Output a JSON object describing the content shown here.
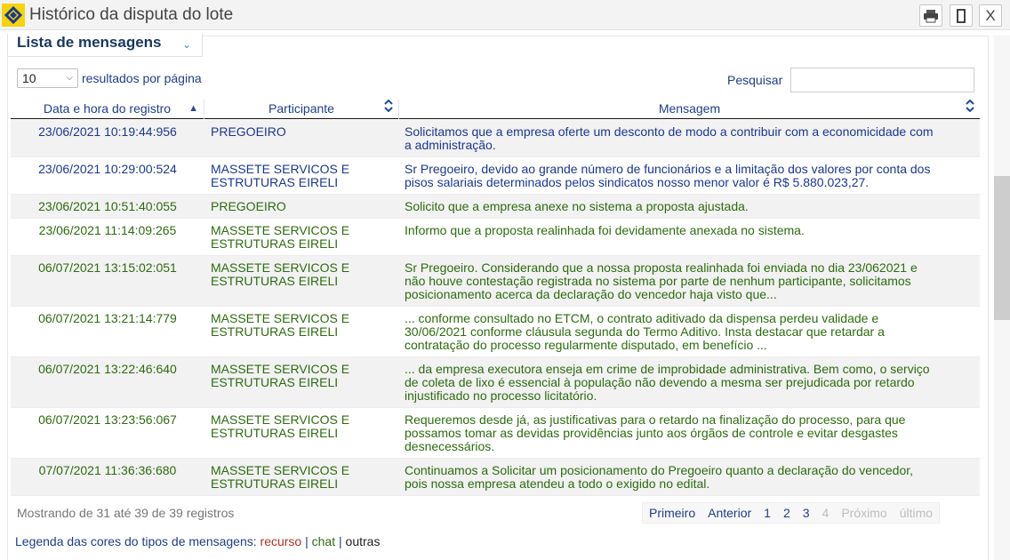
{
  "window": {
    "title": "Histórico da disputa do lote",
    "buttons": {
      "close": "X"
    }
  },
  "tab": {
    "label": "Lista de mensagens"
  },
  "controls": {
    "page_length": "10",
    "page_length_label": "resultados por página",
    "search_label": "Pesquisar",
    "search_value": ""
  },
  "table": {
    "headers": [
      "Data e hora do registro",
      "Participante",
      "Mensagem"
    ],
    "rows": [
      {
        "datetime": "23/06/2021 10:19:44:956",
        "participant": [
          "PREGOEIRO"
        ],
        "message": [
          "Solicitamos que a empresa oferte um desconto de modo a contribuir com a economicidade com",
          "a administração."
        ],
        "type": "blue"
      },
      {
        "datetime": "23/06/2021 10:29:00:524",
        "participant": [
          "MASSETE SERVICOS E",
          "ESTRUTURAS EIRELI"
        ],
        "message": [
          "Sr Pregoeiro, devido ao grande número de funcionários e a limitação dos valores por conta dos",
          "pisos salariais determinados pelos sindicatos nosso menor valor é R$ 5.880.023,27."
        ],
        "type": "blue"
      },
      {
        "datetime": "23/06/2021 10:51:40:055",
        "participant": [
          "PREGOEIRO"
        ],
        "message": [
          "Solicito que a empresa anexe no sistema a proposta ajustada."
        ],
        "type": "green"
      },
      {
        "datetime": "23/06/2021 11:14:09:265",
        "participant": [
          "MASSETE SERVICOS E",
          "ESTRUTURAS EIRELI"
        ],
        "message": [
          "Informo que a proposta realinhada foi devidamente anexada no sistema."
        ],
        "type": "green"
      },
      {
        "datetime": "06/07/2021 13:15:02:051",
        "participant": [
          "MASSETE SERVICOS E",
          "ESTRUTURAS EIRELI"
        ],
        "message": [
          "Sr Pregoeiro. Considerando que a nossa proposta realinhada foi enviada no dia 23/062021 e",
          "não houve contestação registrada no sistema por parte de nenhum participante, solicitamos",
          "posicionamento acerca da declaração do vencedor haja visto que..."
        ],
        "type": "green"
      },
      {
        "datetime": "06/07/2021 13:21:14:779",
        "participant": [
          "MASSETE SERVICOS E",
          "ESTRUTURAS EIRELI"
        ],
        "message": [
          "... conforme consultado no ETCM, o contrato aditivado da dispensa perdeu validade e",
          "30/06/2021 conforme cláusula segunda do Termo Aditivo. Insta destacar que retardar a",
          "contratação do processo regularmente disputado, em benefício ..."
        ],
        "type": "green"
      },
      {
        "datetime": "06/07/2021 13:22:46:640",
        "participant": [
          "MASSETE SERVICOS E",
          "ESTRUTURAS EIRELI"
        ],
        "message": [
          "... da empresa executora enseja em crime de improbidade administrativa. Bem como, o serviço",
          "de coleta de lixo é essencial à população não devendo a mesma ser prejudicada por retardo",
          "injustificado no processo licitatório."
        ],
        "type": "green"
      },
      {
        "datetime": "06/07/2021 13:23:56:067",
        "participant": [
          "MASSETE SERVICOS E",
          "ESTRUTURAS EIRELI"
        ],
        "message": [
          "Requeremos desde já, as justificativas para o retardo na finalização do processo, para que",
          "possamos tomar as devidas providências junto aos órgãos de controle e evitar desgastes",
          "desnecessários."
        ],
        "type": "green"
      },
      {
        "datetime": "07/07/2021 11:36:36:680",
        "participant": [
          "MASSETE SERVICOS E",
          "ESTRUTURAS EIRELI"
        ],
        "message": [
          "Continuamos a Solicitar um posicionamento do Pregoeiro quanto a declaração do vencedor,",
          "pois nossa empresa atendeu a todo o exigido no edital."
        ],
        "type": "green"
      }
    ]
  },
  "footer": {
    "info": "Mostrando de 31 até 39 de 39 registros",
    "pager": [
      {
        "label": "Primeiro",
        "state": "enabled"
      },
      {
        "label": "Anterior",
        "state": "enabled"
      },
      {
        "label": "1",
        "state": "enabled"
      },
      {
        "label": "2",
        "state": "enabled"
      },
      {
        "label": "3",
        "state": "current"
      },
      {
        "label": "4",
        "state": "disabled"
      },
      {
        "label": "Próximo",
        "state": "disabled"
      },
      {
        "label": "último",
        "state": "disabled"
      }
    ]
  },
  "legend": {
    "prefix": "Legenda das cores do tipos de mensagens:",
    "recurso": "recurso",
    "sep": "|",
    "chat": "chat",
    "outras": "outras"
  },
  "colors": {
    "blue_text": "#1c3690",
    "green_text": "#2e6b10",
    "recurso": "#b1321d",
    "logo_yellow": "#f6d40a"
  }
}
